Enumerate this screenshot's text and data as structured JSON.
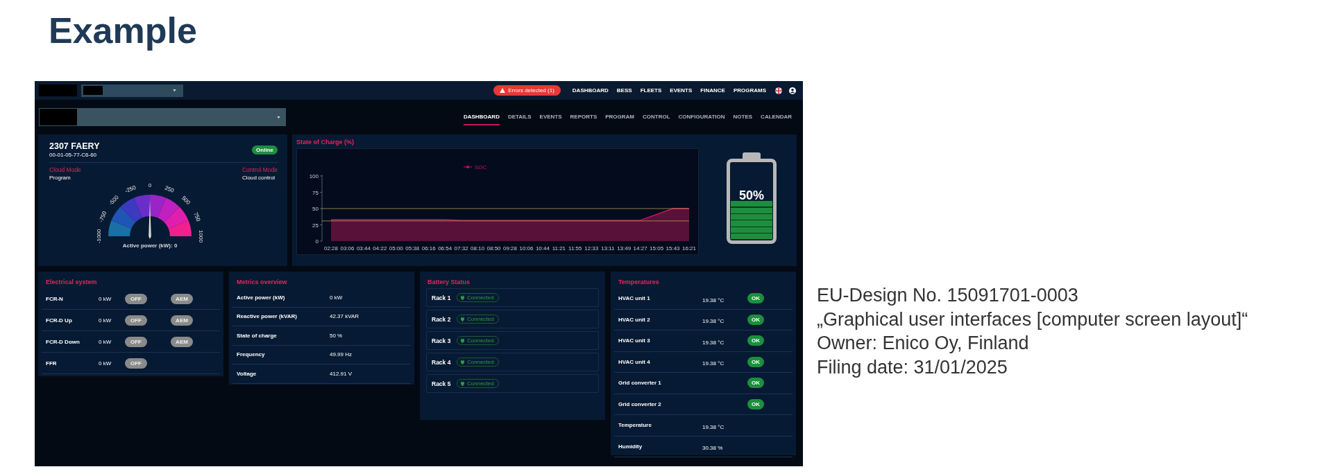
{
  "heading": "Example",
  "app": {
    "topbar": {
      "alert": "Errors detected (1)",
      "nav": [
        "DASHBOARD",
        "BESS",
        "FLEETS",
        "EVENTS",
        "FINANCE",
        "PROGRAMS"
      ]
    },
    "tabs": [
      {
        "label": "DASHBOARD",
        "selected": true
      },
      {
        "label": "DETAILS",
        "selected": false
      },
      {
        "label": "EVENTS",
        "selected": false
      },
      {
        "label": "REPORTS",
        "selected": false
      },
      {
        "label": "PROGRAM",
        "selected": false
      },
      {
        "label": "CONTROL",
        "selected": false
      },
      {
        "label": "CONFIGURATION",
        "selected": false
      },
      {
        "label": "NOTES",
        "selected": false
      },
      {
        "label": "CALENDAR",
        "selected": false
      }
    ],
    "device": {
      "name": "2307 FAERY",
      "id": "00-01-05-77-C6-60",
      "status": "Online",
      "modes": [
        {
          "label": "Cloud Mode",
          "value": "Program"
        },
        {
          "label": "Control Mode",
          "value": "Cloud control"
        }
      ],
      "gauge": {
        "ticks": [
          "-1000",
          "-750",
          "-500",
          "-250",
          "0",
          "250",
          "500",
          "750",
          "1000"
        ],
        "caption": "Active power (kW): 0",
        "level": 0.5
      }
    },
    "soc": {
      "title": "State of Charge (%)",
      "chart_data": {
        "type": "area",
        "categories": [
          "02:28",
          "03:06",
          "03:44",
          "04:22",
          "05:00",
          "05:38",
          "06:16",
          "06:54",
          "07:32",
          "08:10",
          "08:50",
          "09:28",
          "10:06",
          "10:44",
          "11:21",
          "11:55",
          "12:33",
          "13:11",
          "13:49",
          "14:27",
          "15:05",
          "15:43",
          "16:21"
        ],
        "series": [
          {
            "name": "SOC",
            "color": "#c2185b",
            "values": [
              33,
              33,
              33,
              33,
              33,
              33,
              33,
              33,
              32,
              32,
              32,
              32,
              32,
              32,
              32,
              32,
              32,
              32,
              32,
              32,
              41,
              50,
              50
            ]
          }
        ],
        "ylim": [
          0,
          100
        ],
        "yticks": [
          0,
          25,
          50,
          75,
          100
        ],
        "ref_lines": [
          {
            "axis": "y",
            "value": 50,
            "color": "#c8b44a"
          },
          {
            "axis": "y",
            "value": 31,
            "color": "#c8b44a"
          }
        ]
      },
      "battery": {
        "label": "50%",
        "level": 0.5
      }
    },
    "electrical": {
      "title": "Electrical system",
      "rows": [
        {
          "name": "FCR-N",
          "value": "0 kW",
          "toggle": {
            "label": "OFF",
            "on": false
          },
          "aem": "AEM"
        },
        {
          "name": "FCR-D Up",
          "value": "0 kW",
          "toggle": {
            "label": "OFF",
            "on": false
          },
          "aem": "AEM"
        },
        {
          "name": "FCR-D Down",
          "value": "0 kW",
          "toggle": {
            "label": "OFF",
            "on": false
          },
          "aem": "AEM"
        },
        {
          "name": "FFR",
          "value": "0 kW",
          "toggle": {
            "label": "OFF",
            "on": false
          }
        }
      ]
    },
    "metrics": {
      "title": "Metrics overview",
      "rows": [
        {
          "name": "Active power (kW)",
          "value": "0 kW"
        },
        {
          "name": "Reactive power (kVAR)",
          "value": "42.37 kVAR"
        },
        {
          "name": "State of charge",
          "value": "50 %"
        },
        {
          "name": "Frequency",
          "value": "49.99 Hz"
        },
        {
          "name": "Voltage",
          "value": "412.91 V"
        }
      ]
    },
    "battery_status": {
      "title": "Battery Status",
      "racks": [
        {
          "name": "Rack 1",
          "status": "Connected"
        },
        {
          "name": "Rack 2",
          "status": "Connected"
        },
        {
          "name": "Rack 3",
          "status": "Connected"
        },
        {
          "name": "Rack 4",
          "status": "Connected"
        },
        {
          "name": "Rack 5",
          "status": "Connected"
        }
      ]
    },
    "temperatures": {
      "title": "Temperatures",
      "rows": [
        {
          "name": "HVAC unit 1",
          "value": "19.38 °C",
          "status": "OK"
        },
        {
          "name": "HVAC unit 2",
          "value": "19.38 °C",
          "status": "OK"
        },
        {
          "name": "HVAC unit 3",
          "value": "19.38 °C",
          "status": "OK"
        },
        {
          "name": "HVAC unit 4",
          "value": "19.38 °C",
          "status": "OK"
        },
        {
          "name": "Grid converter 1",
          "status": "OK"
        },
        {
          "name": "Grid converter 2",
          "status": "OK"
        },
        {
          "name": "Temperature",
          "value": "19.38 °C"
        },
        {
          "name": "Humidity",
          "value": "30.38 %"
        }
      ]
    }
  },
  "caption": [
    "EU-Design No. 15091701-0003",
    "„Graphical user interfaces [computer screen layout]“",
    "Owner: Enico Oy, Finland",
    "Filing date: 31/01/2025"
  ]
}
